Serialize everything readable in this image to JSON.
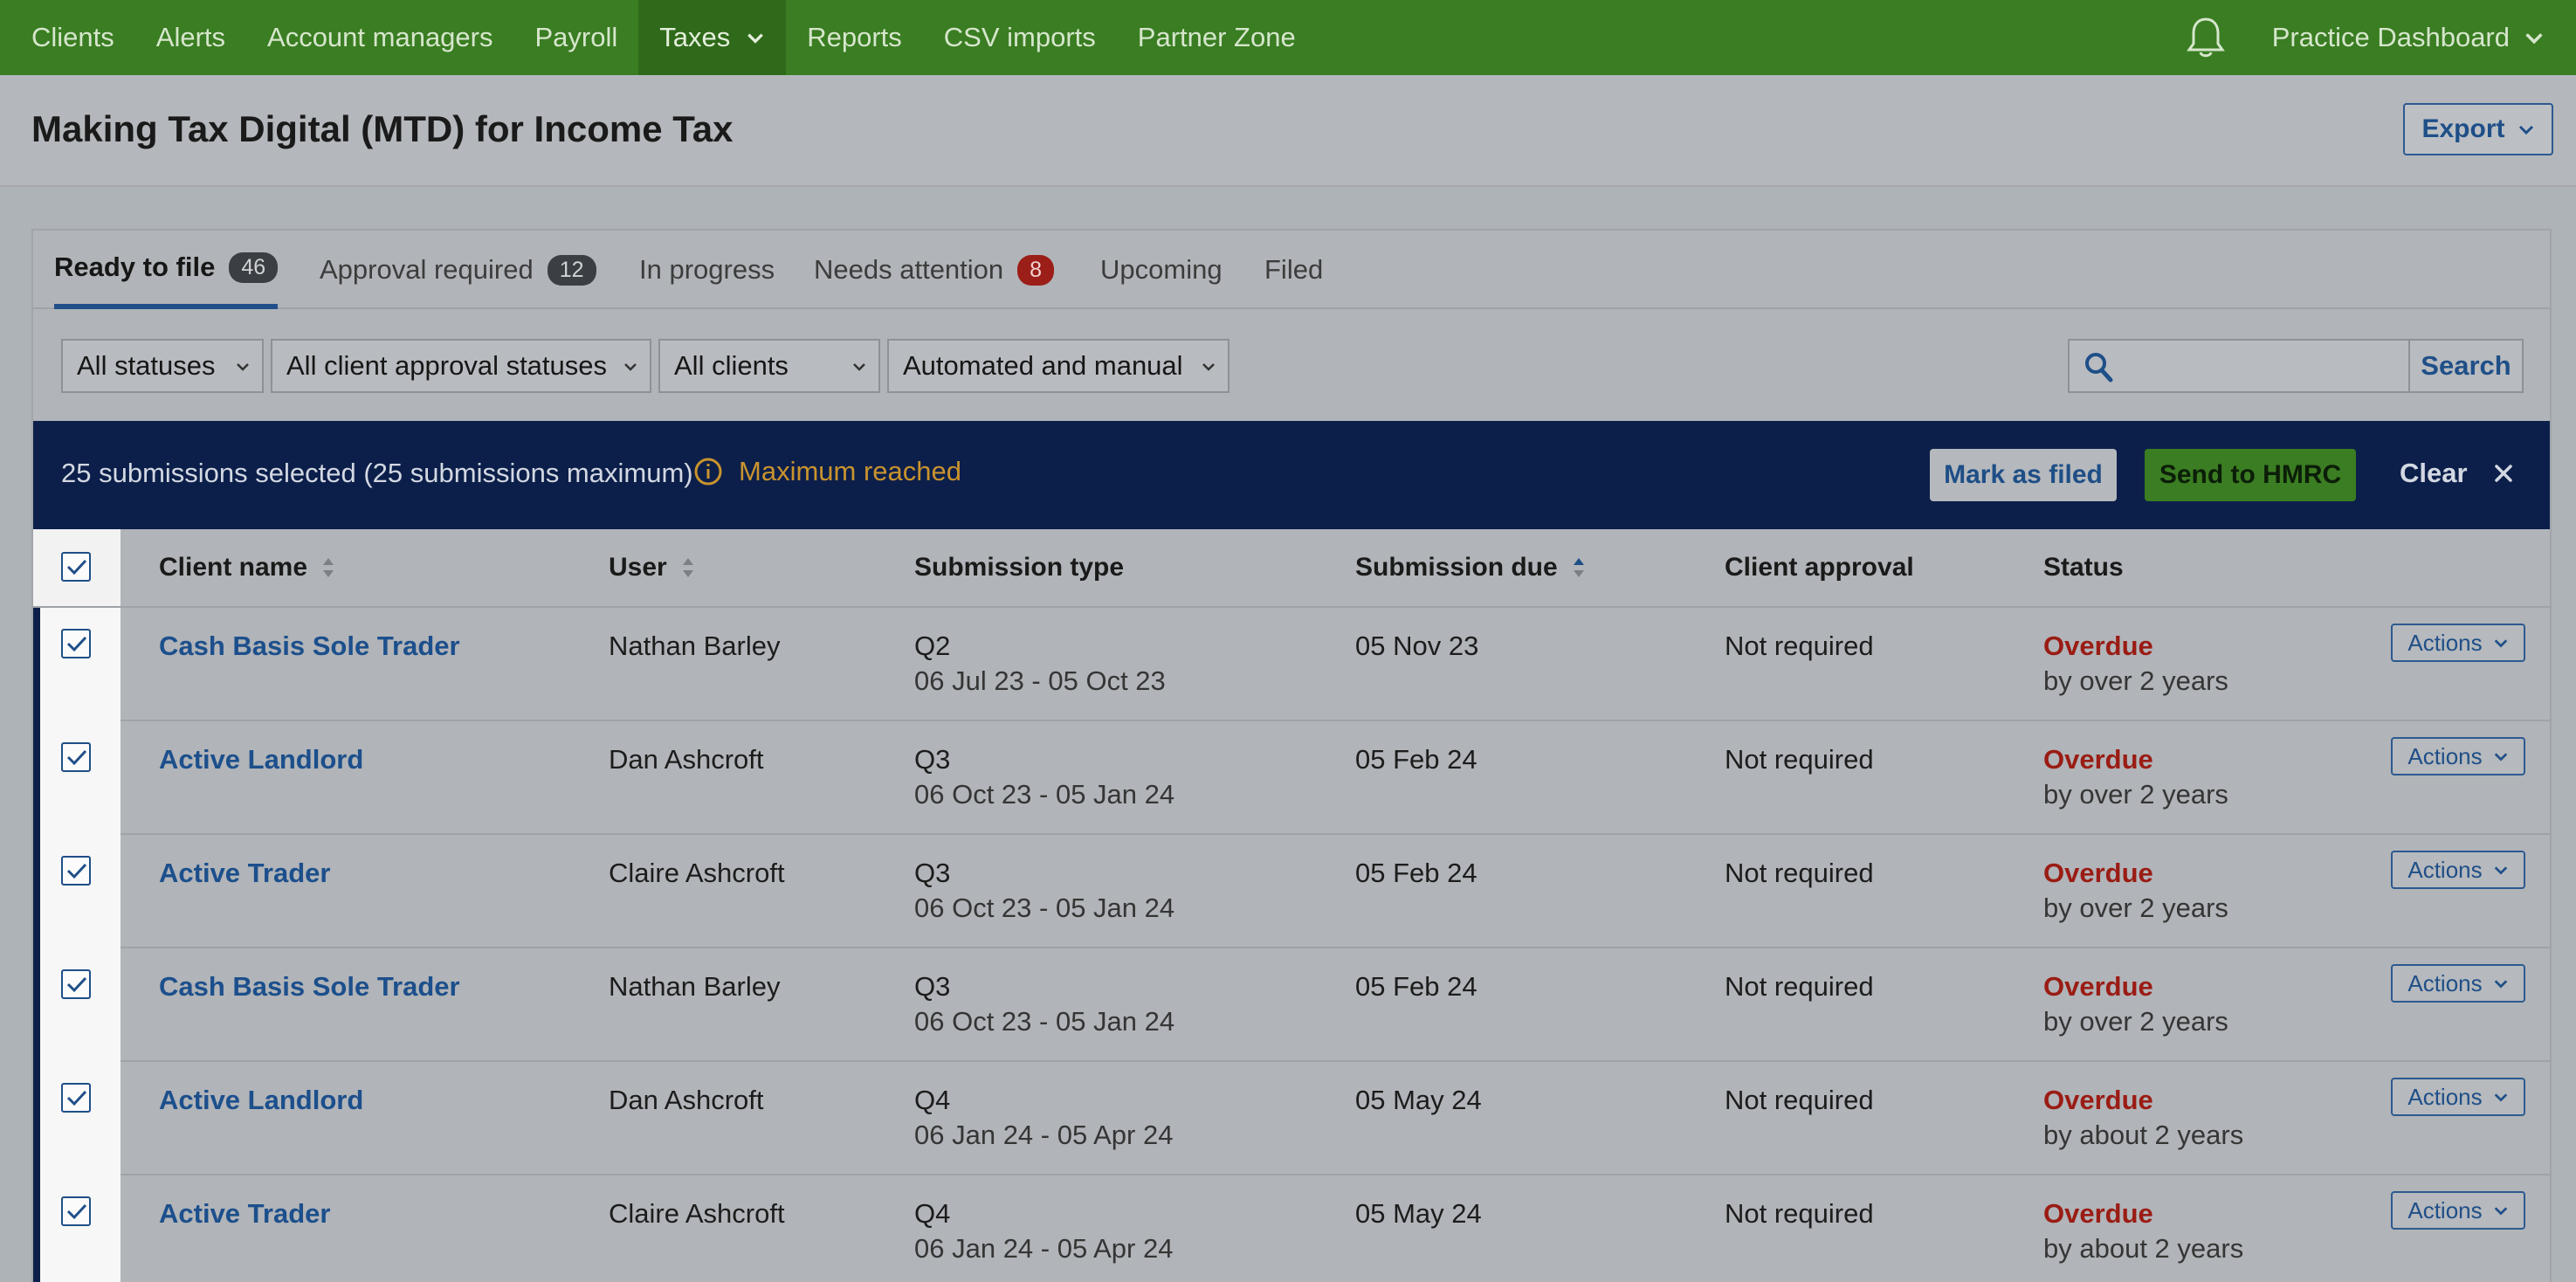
{
  "nav": {
    "items": [
      {
        "label": "Clients"
      },
      {
        "label": "Alerts"
      },
      {
        "label": "Account managers"
      },
      {
        "label": "Payroll"
      },
      {
        "label": "Taxes"
      },
      {
        "label": "Reports"
      },
      {
        "label": "CSV imports"
      },
      {
        "label": "Partner Zone"
      }
    ],
    "active": "Taxes",
    "practice_label": "Practice Dashboard",
    "bell_icon": "bell-icon"
  },
  "page": {
    "title": "Making Tax Digital (MTD) for Income Tax",
    "export_label": "Export"
  },
  "tabs": [
    {
      "label": "Ready to file",
      "count": "46"
    },
    {
      "label": "Approval required",
      "count": "12"
    },
    {
      "label": "In progress",
      "count": ""
    },
    {
      "label": "Needs attention",
      "count": "8"
    },
    {
      "label": "Upcoming",
      "count": ""
    },
    {
      "label": "Filed",
      "count": ""
    }
  ],
  "filters": {
    "status": "All statuses",
    "approval": "All client approval statuses",
    "clients": "All clients",
    "mode": "Automated and manual",
    "search_value": "",
    "search_label": "Search"
  },
  "selection": {
    "text": "25 submissions selected (25 submissions maximum)",
    "warning": "Maximum reached",
    "mark_filed": "Mark as filed",
    "send": "Send to HMRC",
    "clear": "Clear"
  },
  "table": {
    "headers": {
      "client": "Client name",
      "user": "User",
      "type": "Submission type",
      "due": "Submission due",
      "approval": "Client approval",
      "status": "Status"
    },
    "actions_label": "Actions",
    "rows": [
      {
        "client": "Cash Basis Sole Trader",
        "user": "Nathan Barley",
        "quarter": "Q2",
        "period": "06 Jul 23 - 05 Oct 23",
        "due": "05 Nov 23",
        "approval": "Not required",
        "status": "Overdue",
        "status_detail": "by over 2 years"
      },
      {
        "client": "Active Landlord",
        "user": "Dan Ashcroft",
        "quarter": "Q3",
        "period": "06 Oct 23 - 05 Jan 24",
        "due": "05 Feb 24",
        "approval": "Not required",
        "status": "Overdue",
        "status_detail": "by over 2 years"
      },
      {
        "client": "Active Trader",
        "user": "Claire Ashcroft",
        "quarter": "Q3",
        "period": "06 Oct 23 - 05 Jan 24",
        "due": "05 Feb 24",
        "approval": "Not required",
        "status": "Overdue",
        "status_detail": "by over 2 years"
      },
      {
        "client": "Cash Basis Sole Trader",
        "user": "Nathan Barley",
        "quarter": "Q3",
        "period": "06 Oct 23 - 05 Jan 24",
        "due": "05 Feb 24",
        "approval": "Not required",
        "status": "Overdue",
        "status_detail": "by over 2 years"
      },
      {
        "client": "Active Landlord",
        "user": "Dan Ashcroft",
        "quarter": "Q4",
        "period": "06 Jan 24 - 05 Apr 24",
        "due": "05 May 24",
        "approval": "Not required",
        "status": "Overdue",
        "status_detail": "by about 2 years"
      },
      {
        "client": "Active Trader",
        "user": "Claire Ashcroft",
        "quarter": "Q4",
        "period": "06 Jan 24 - 05 Apr 24",
        "due": "05 May 24",
        "approval": "Not required",
        "status": "Overdue",
        "status_detail": "by about 2 years"
      }
    ]
  },
  "colors": {
    "nav_bg": "#3a7d22",
    "banner_bg": "#0c1f4a",
    "link": "#1c4f8c",
    "overdue": "#9a1c14",
    "warning": "#c9932e"
  }
}
